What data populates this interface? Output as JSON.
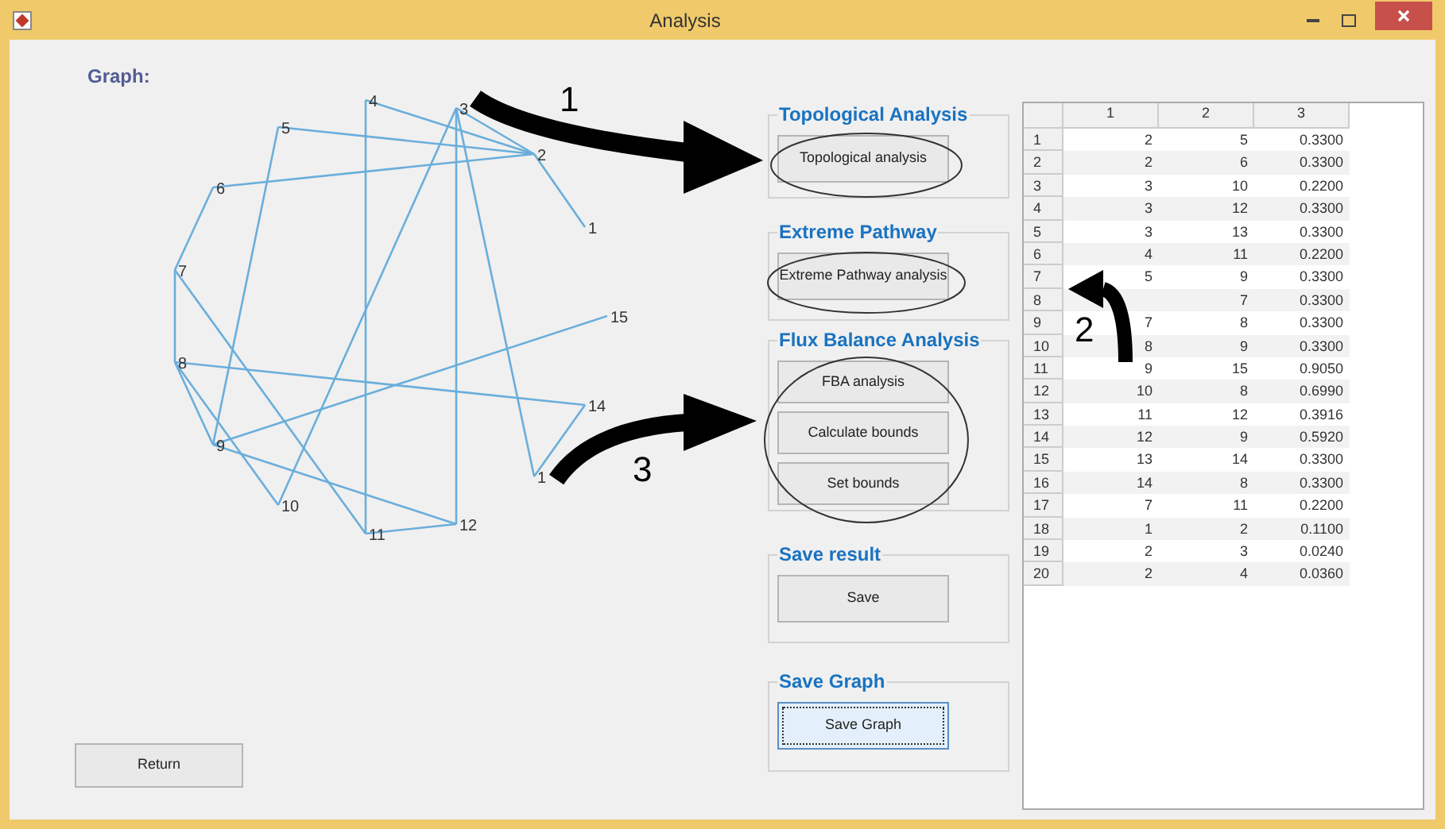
{
  "window": {
    "title": "Analysis"
  },
  "graph": {
    "label": "Graph:",
    "nodes": [
      "1",
      "2",
      "3",
      "4",
      "5",
      "6",
      "7",
      "8",
      "9",
      "10",
      "11",
      "12",
      "1",
      "14",
      "15"
    ]
  },
  "return_button": "Return",
  "groups": [
    {
      "title": "Topological Analysis",
      "buttons": [
        {
          "label": "Topological analysis",
          "focused": false
        }
      ]
    },
    {
      "title": "Extreme Pathway",
      "buttons": [
        {
          "label": "Extreme Pathway analysis",
          "focused": false
        }
      ]
    },
    {
      "title": "Flux Balance Analysis",
      "buttons": [
        {
          "label": "FBA analysis",
          "focused": false
        },
        {
          "label": "Calculate bounds",
          "focused": false
        },
        {
          "label": "Set bounds",
          "focused": false
        }
      ]
    },
    {
      "title": "Save result",
      "buttons": [
        {
          "label": "Save",
          "focused": false
        }
      ]
    },
    {
      "title": "Save Graph",
      "buttons": [
        {
          "label": "Save Graph",
          "focused": true
        }
      ]
    }
  ],
  "table": {
    "columns": [
      "1",
      "2",
      "3"
    ],
    "rows": [
      {
        "index": "1",
        "cells": [
          "2",
          "5",
          "0.3300"
        ]
      },
      {
        "index": "2",
        "cells": [
          "2",
          "6",
          "0.3300"
        ]
      },
      {
        "index": "3",
        "cells": [
          "3",
          "10",
          "0.2200"
        ]
      },
      {
        "index": "4",
        "cells": [
          "3",
          "12",
          "0.3300"
        ]
      },
      {
        "index": "5",
        "cells": [
          "3",
          "13",
          "0.3300"
        ]
      },
      {
        "index": "6",
        "cells": [
          "4",
          "11",
          "0.2200"
        ]
      },
      {
        "index": "7",
        "cells": [
          "5",
          "9",
          "0.3300"
        ]
      },
      {
        "index": "8",
        "cells": [
          null,
          "7",
          "0.3300"
        ]
      },
      {
        "index": "9",
        "cells": [
          "7",
          "8",
          "0.3300"
        ]
      },
      {
        "index": "10",
        "cells": [
          "8",
          "9",
          "0.3300"
        ]
      },
      {
        "index": "11",
        "cells": [
          "9",
          "15",
          "0.9050"
        ]
      },
      {
        "index": "12",
        "cells": [
          "10",
          "8",
          "0.6990"
        ]
      },
      {
        "index": "13",
        "cells": [
          "11",
          "12",
          "0.3916"
        ]
      },
      {
        "index": "14",
        "cells": [
          "12",
          "9",
          "0.5920"
        ]
      },
      {
        "index": "15",
        "cells": [
          "13",
          "14",
          "0.3300"
        ]
      },
      {
        "index": "16",
        "cells": [
          "14",
          "8",
          "0.3300"
        ]
      },
      {
        "index": "17",
        "cells": [
          "7",
          "11",
          "0.2200"
        ]
      },
      {
        "index": "18",
        "cells": [
          "1",
          "2",
          "0.1100"
        ]
      },
      {
        "index": "19",
        "cells": [
          "2",
          "3",
          "0.0240"
        ]
      },
      {
        "index": "20",
        "cells": [
          "2",
          "4",
          "0.0360"
        ]
      }
    ]
  },
  "annotations": [
    "1",
    "2",
    "3"
  ]
}
